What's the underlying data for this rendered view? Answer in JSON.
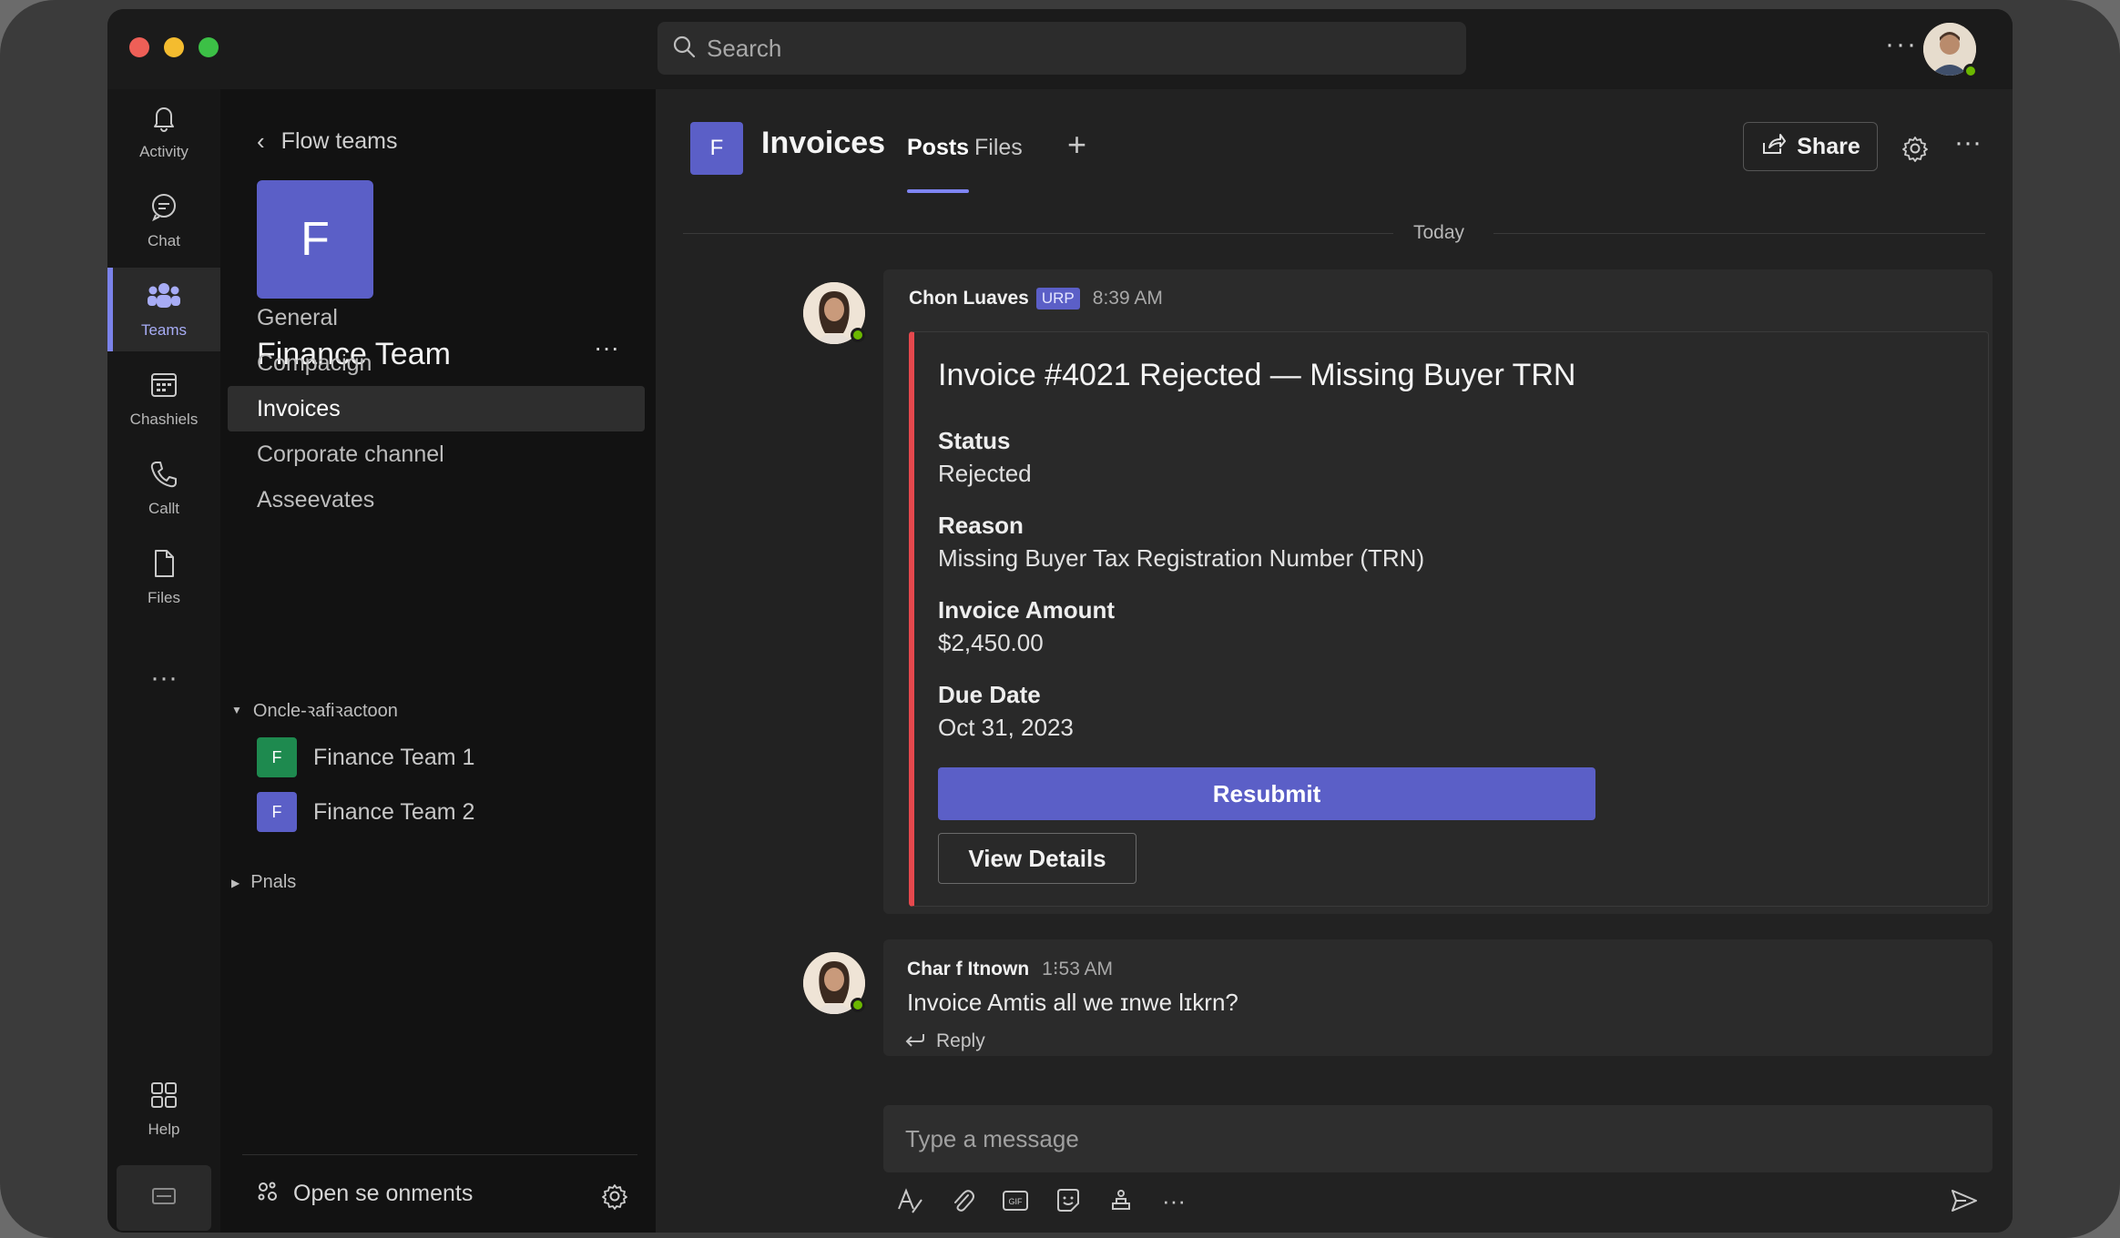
{
  "search": {
    "placeholder": "Search"
  },
  "rail": {
    "items": [
      {
        "label": "Activity",
        "icon": "bell-icon"
      },
      {
        "label": "Chat",
        "icon": "chat-icon"
      },
      {
        "label": "Teams",
        "icon": "teams-icon",
        "active": true
      },
      {
        "label": "Chashiels",
        "icon": "calendar-icon"
      },
      {
        "label": "Callt",
        "icon": "phone-icon"
      },
      {
        "label": "Files",
        "icon": "file-icon"
      }
    ],
    "more": "···",
    "help_label": "Help"
  },
  "panel": {
    "back_label": "Flow teams",
    "team_initial": "F",
    "team_name": "Finance Team",
    "channels": [
      "General",
      "Compacign",
      "Invoices",
      "Corporate channel",
      "Asseevates"
    ],
    "active_channel": "Invoices",
    "group_label": "Oncle-ꝛafiꝛactoon",
    "sub_teams": [
      {
        "initial": "F",
        "name": "Finance Team 1",
        "color": "#1e8a4f"
      },
      {
        "initial": "F",
        "name": "Finance Team 2",
        "color": "#5b5fc7"
      }
    ],
    "group2_label": "Pnals",
    "footer_label": "Open se onments"
  },
  "header": {
    "channel_initial": "F",
    "channel_title": "Invoices",
    "tabs": [
      "Posts",
      "Files"
    ],
    "active_tab": "Posts",
    "share_label": "Share"
  },
  "feed": {
    "day_label": "Today",
    "messages": [
      {
        "author": "Chon Luaves",
        "badge": "URP",
        "time": "8:39 AM",
        "card": {
          "title": "Invoice #4021 Rejected — Missing Buyer TRN",
          "fields": [
            {
              "label": "Status",
              "value": "Rejected"
            },
            {
              "label": "Reason",
              "value": "Missing Buyer Tax Registration Number (TRN)"
            },
            {
              "label": "Invoice Amount",
              "value": "$2,450.00"
            },
            {
              "label": "Due Date",
              "value": "Oct 31, 2023"
            }
          ],
          "primary_action": "Resubmit",
          "secondary_action": "View Details",
          "accent_color": "#e5484d"
        }
      },
      {
        "author": "Char f Itnown",
        "time": "1⁝53 AM",
        "text": "Invoice Amtis all we ɪnwe lɪkrn?",
        "reply_label": "Reply"
      }
    ]
  },
  "composer": {
    "placeholder": "Type a message"
  },
  "colors": {
    "accent": "#5b5fc7",
    "presence": "#6bb700",
    "reject": "#e5484d"
  }
}
